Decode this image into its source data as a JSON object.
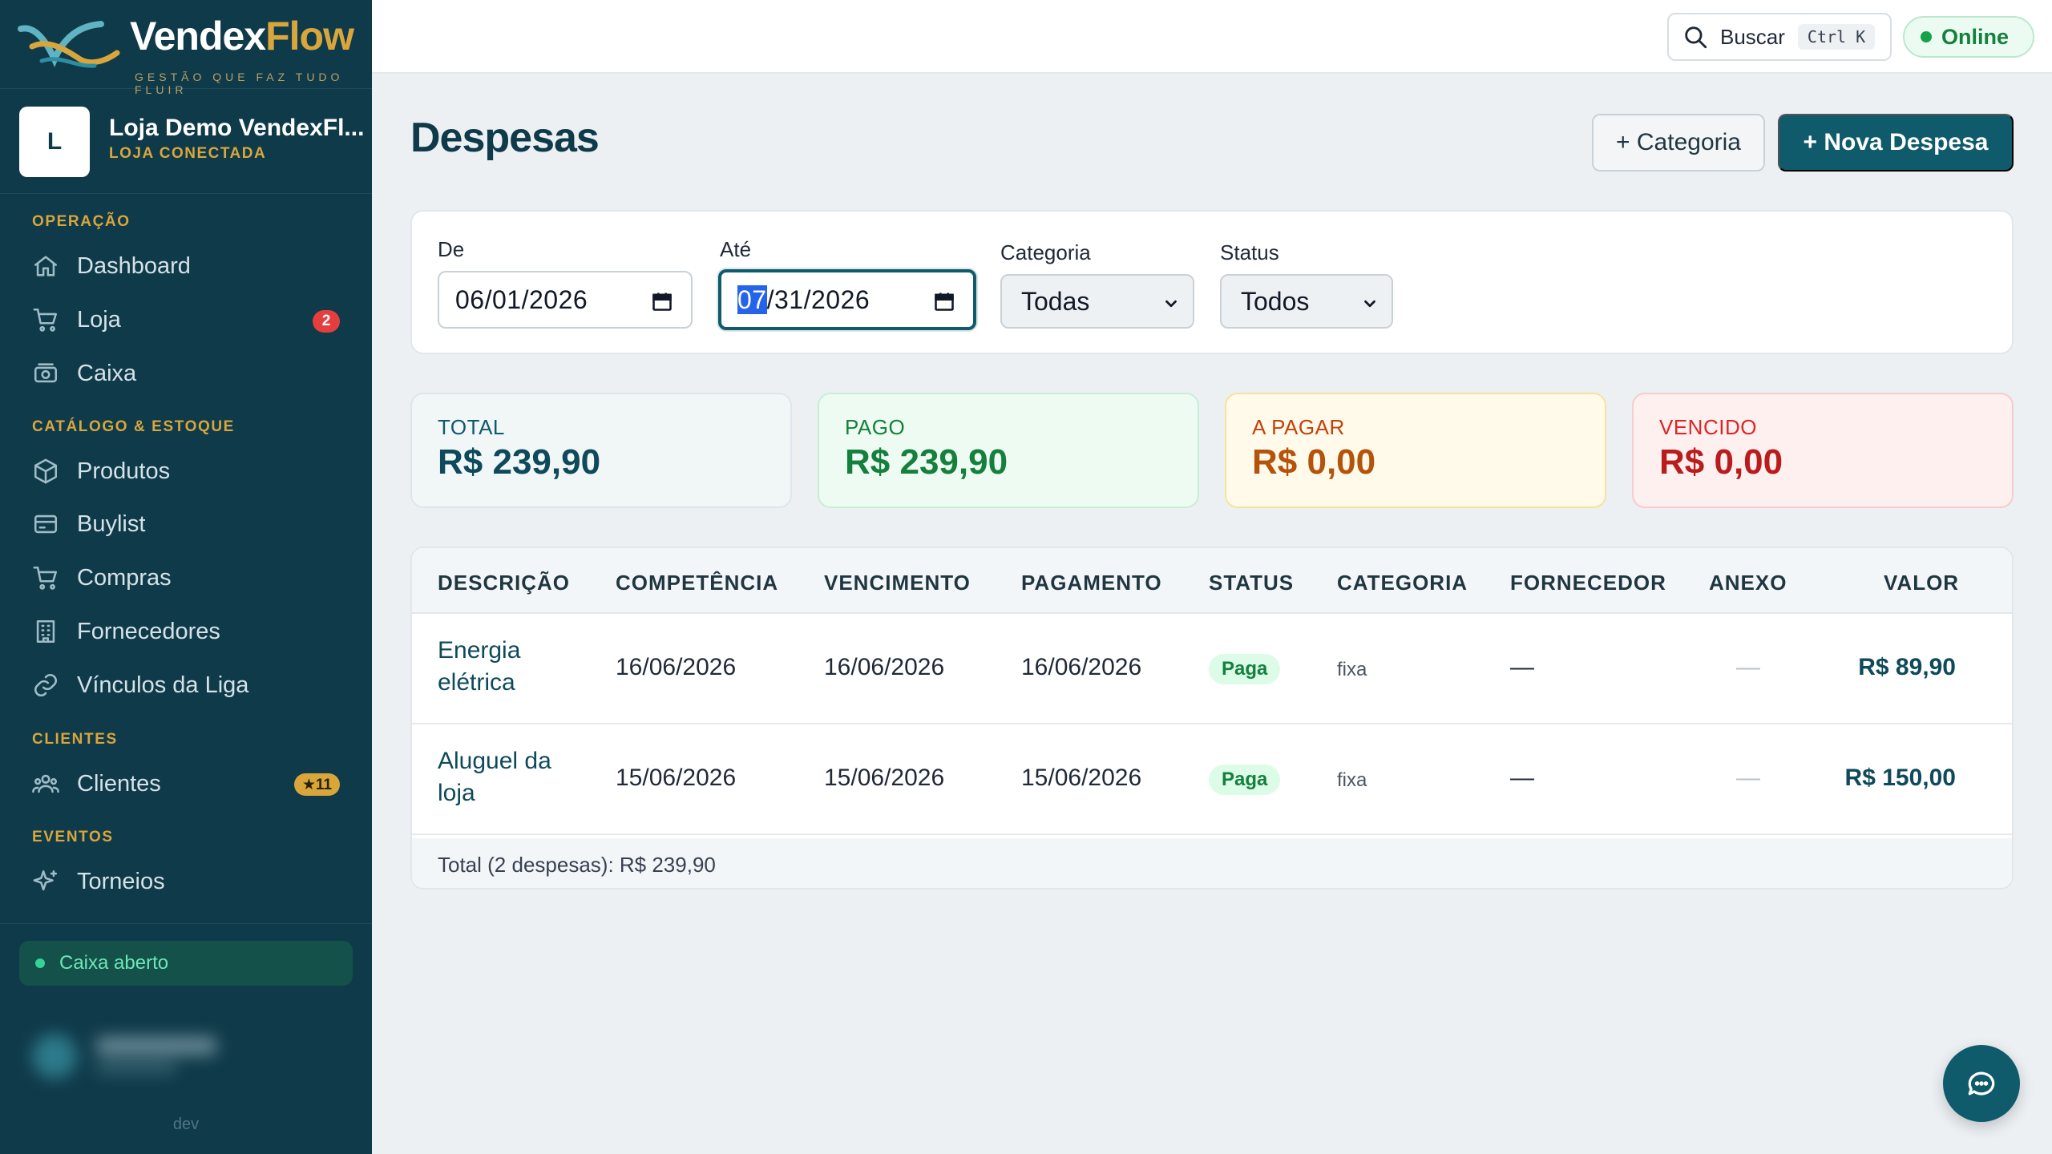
{
  "brand": {
    "name_part1": "Vendex",
    "name_part2": "Flow",
    "tagline": "GESTÃO QUE FAZ TUDO FLUIR",
    "colors": {
      "sidebar": "#0f3a4a",
      "accent_gold": "#d9a63c",
      "primary": "#0f5a6b"
    }
  },
  "store": {
    "avatar_letter": "L",
    "name": "Loja Demo VendexFl...",
    "status": "LOJA CONECTADA"
  },
  "sidebar": {
    "sections": [
      {
        "title": "OPERAÇÃO",
        "items": [
          {
            "label": "Dashboard",
            "icon": "home-icon"
          },
          {
            "label": "Loja",
            "icon": "cart-icon",
            "badge": "2"
          },
          {
            "label": "Caixa",
            "icon": "cash-register-icon"
          }
        ]
      },
      {
        "title": "CATÁLOGO & ESTOQUE",
        "items": [
          {
            "label": "Produtos",
            "icon": "box-icon"
          },
          {
            "label": "Buylist",
            "icon": "card-icon"
          },
          {
            "label": "Compras",
            "icon": "cart-icon"
          },
          {
            "label": "Fornecedores",
            "icon": "building-icon"
          },
          {
            "label": "Vínculos da Liga",
            "icon": "link-icon"
          }
        ]
      },
      {
        "title": "CLIENTES",
        "items": [
          {
            "label": "Clientes",
            "icon": "users-icon",
            "badge": "★11"
          }
        ]
      },
      {
        "title": "EVENTOS",
        "items": [
          {
            "label": "Torneios",
            "icon": "sparkle-icon"
          }
        ]
      }
    ],
    "cash_status": "Caixa aberto",
    "environment": "dev"
  },
  "topbar": {
    "search_label": "Buscar",
    "search_shortcut": "Ctrl K",
    "connection_status": "Online"
  },
  "page": {
    "title": "Despesas",
    "add_category_label": "+ Categoria",
    "new_expense_label": "+ Nova Despesa"
  },
  "filters": {
    "from_label": "De",
    "from_value": "06/01/2026",
    "to_label": "Até",
    "to_value_highlight": "07",
    "to_value_rest": "/31/2026",
    "category_label": "Categoria",
    "category_value": "Todas",
    "status_label": "Status",
    "status_value": "Todos"
  },
  "summary": {
    "total_label": "TOTAL",
    "total_value": "R$ 239,90",
    "paid_label": "PAGO",
    "paid_value": "R$ 239,90",
    "to_pay_label": "A PAGAR",
    "to_pay_value": "R$ 0,00",
    "overdue_label": "VENCIDO",
    "overdue_value": "R$ 0,00"
  },
  "table": {
    "headers": [
      "DESCRIÇÃO",
      "COMPETÊNCIA",
      "VENCIMENTO",
      "PAGAMENTO",
      "STATUS",
      "CATEGORIA",
      "FORNECEDOR",
      "ANEXO",
      "VALOR"
    ],
    "rows": [
      {
        "description_line1": "Energia",
        "description_line2": "elétrica",
        "competence": "16/06/2026",
        "due": "16/06/2026",
        "payment": "16/06/2026",
        "status": "Paga",
        "category": "fixa",
        "supplier": "—",
        "attachment": "—",
        "amount": "R$ 89,90"
      },
      {
        "description_line1": "Aluguel da",
        "description_line2": "loja",
        "competence": "15/06/2026",
        "due": "15/06/2026",
        "payment": "15/06/2026",
        "status": "Paga",
        "category": "fixa",
        "supplier": "—",
        "attachment": "—",
        "amount": "R$ 150,00"
      }
    ],
    "footer": "Total (2 despesas): R$ 239,90"
  }
}
